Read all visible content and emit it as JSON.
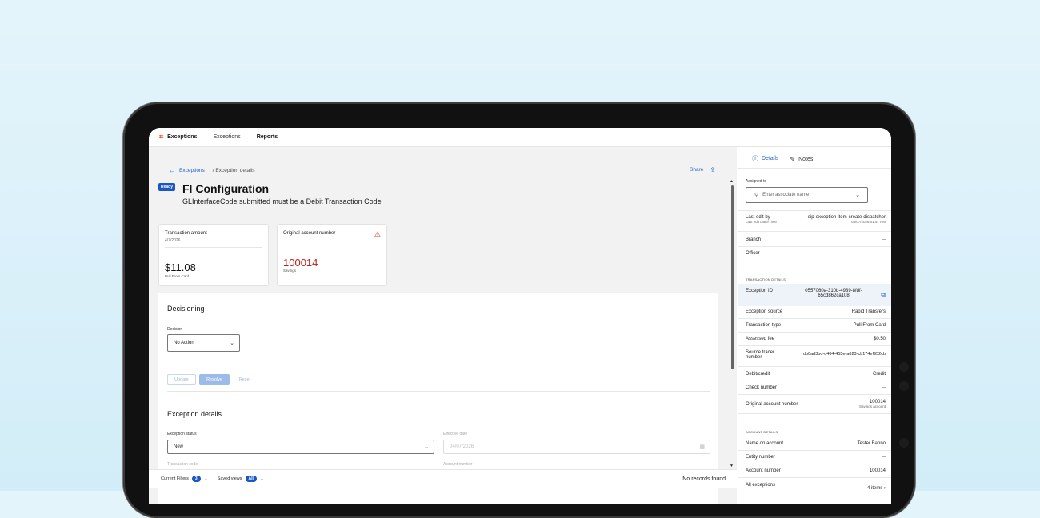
{
  "topbar": {
    "brand": "Exceptions",
    "nav": [
      "Exceptions",
      "Reports"
    ]
  },
  "breadcrumb": {
    "back": "Exceptions",
    "current": "/ Exception details"
  },
  "share_label": "Share",
  "status_badge": "Ready",
  "title": "FI Configuration",
  "subtitle": "GLInterfaceCode submitted must be a Debit Transaction Code",
  "card_amount": {
    "label": "Transaction amount",
    "date": "4/7/2026",
    "value": "$11.08",
    "note": "Pull From Card"
  },
  "card_account": {
    "label": "Original account number",
    "value": "100014",
    "note": "Savings"
  },
  "decisioning": {
    "heading": "Decisioning",
    "decision_label": "Decision",
    "decision_value": "No Action",
    "buttons": {
      "update": "Update",
      "resolve": "Resolve",
      "reset": "Reset"
    }
  },
  "exception_details": {
    "heading": "Exception details",
    "status_label": "Exception status",
    "status_value": "New",
    "effective_label": "Effective date",
    "effective_value": "04/07/2026",
    "txcode_label": "Transaction code",
    "account_label": "Account number"
  },
  "filterbar": {
    "current_filters": "Current Filters",
    "filter_count": "3",
    "saved_views": "Saved views",
    "saved_value": "All",
    "no_records": "No records found"
  },
  "side": {
    "tabs": [
      "Details",
      "Notes"
    ],
    "assigned_label": "Assigned to",
    "assigned_placeholder": "Enter associate name",
    "last_edit_by_label": "Last edit by",
    "last_edit_by_value": "eip-exception-item-create-dispatcher",
    "last_edit_dt_label": "Last edit Date/Time",
    "last_edit_dt_value": "04/07/2026 01:57 PM",
    "branch_label": "Branch",
    "branch_value": "--",
    "officer_label": "Officer",
    "officer_value": "--",
    "tx_section": "TRANSACTION DETAILS",
    "exception_id_label": "Exception ID",
    "exception_id_value": "0557060a-310b-4939-8fdf-65cd862ca108",
    "source_label": "Exception source",
    "source_value": "Rapid Transfers",
    "txtype_label": "Transaction type",
    "txtype_value": "Pull From Card",
    "fee_label": "Assessed fee",
    "fee_value": "$0.50",
    "tracer_label": "Source tracer number",
    "tracer_value": "db0ad3bd-d404-455e-a623-cb174ef952cb",
    "debitcredit_label": "Debit/credit",
    "debitcredit_value": "Credit",
    "check_label": "Check number",
    "check_value": "--",
    "orig_acct_label": "Original account number",
    "orig_acct_value": "100014",
    "orig_acct_sub": "Savings account",
    "acct_section": "ACCOUNT DETAILS",
    "name_label": "Name on account",
    "name_value": "Tester Banno",
    "entity_label": "Entity number",
    "entity_value": "--",
    "acctnum_label": "Account number",
    "acctnum_value": "100014",
    "allexc_label": "All exceptions",
    "allexc_value": "4 items"
  }
}
